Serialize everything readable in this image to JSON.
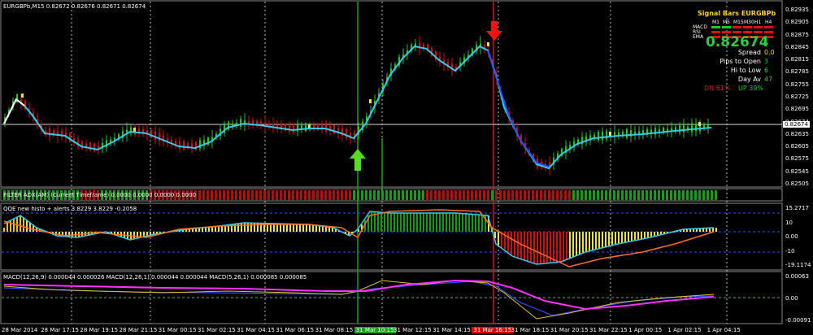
{
  "main": {
    "title": "EURGBPb,M15  0.82672 0.82676 0.82671 0.82674",
    "price_current": "0.82674",
    "axis_ticks": [
      "0.82935",
      "0.82905",
      "0.82875",
      "0.82845",
      "0.82815",
      "0.82785",
      "0.82755",
      "0.82725",
      "0.82695",
      "0.82674",
      "0.82635",
      "0.82605",
      "0.82575",
      "0.82545",
      "0.82505"
    ]
  },
  "signal": {
    "title": "Signal Bars EURGBPb",
    "timeframes": [
      "M1",
      "M5",
      "M15",
      "M30",
      "H1",
      "H4"
    ],
    "indicators": [
      "MACD",
      "RSI",
      "EMA"
    ],
    "price": "0.82674",
    "rows": [
      {
        "label": "Spread",
        "value": "0.0"
      },
      {
        "label": "Pips to Open",
        "value": "3"
      },
      {
        "label": "Hi to Low",
        "value": "6"
      },
      {
        "label": "Day Av",
        "value": "47"
      }
    ],
    "dn": "DN 61%",
    "up": "UP 39%",
    "colors": {
      "up": "#1ec81e",
      "dn": "#e01010",
      "title": "#ffd400",
      "value": "#2ecc40"
    }
  },
  "filter": {
    "title": "FILTER ADX(AM) (Current Timeframe) 0.0000 0.0000 0.0000 0.0000"
  },
  "qqe": {
    "title": "QQE new histo + alerts 3.8229 3.8229 -0.2058",
    "axis_ticks": [
      "15.2717",
      "10",
      "0.00",
      "-10",
      "-19.1174"
    ]
  },
  "macd": {
    "title": "MACD(12,26,9) 0.000044 0.000026  MACD(12,26,1) 0.000044 0.000044  MACD(5,26,1) 0.000085 0.000085",
    "axis_ticks": [
      "0.00063",
      "0.00",
      "-0.00091"
    ]
  },
  "time_axis": [
    "28 Mar 2014",
    "28 Mar 17:15",
    "28 Mar 19:15",
    "28 Mar 21:15",
    "31 Mar 00:15",
    "31 Mar 02:15",
    "31 Mar 04:15",
    "31 Mar 06:15",
    "31 Mar 08:15",
    "31 Mar 10:15",
    "31 Mar 12:15",
    "31 Mar 14:15",
    "31 Mar 16:15",
    "31 Mar 18:15",
    "31 Mar 20:15",
    "31 Mar 22:15",
    "1 Apr 00:15",
    "1 Apr 02:15",
    "1 Apr 04:15"
  ]
}
